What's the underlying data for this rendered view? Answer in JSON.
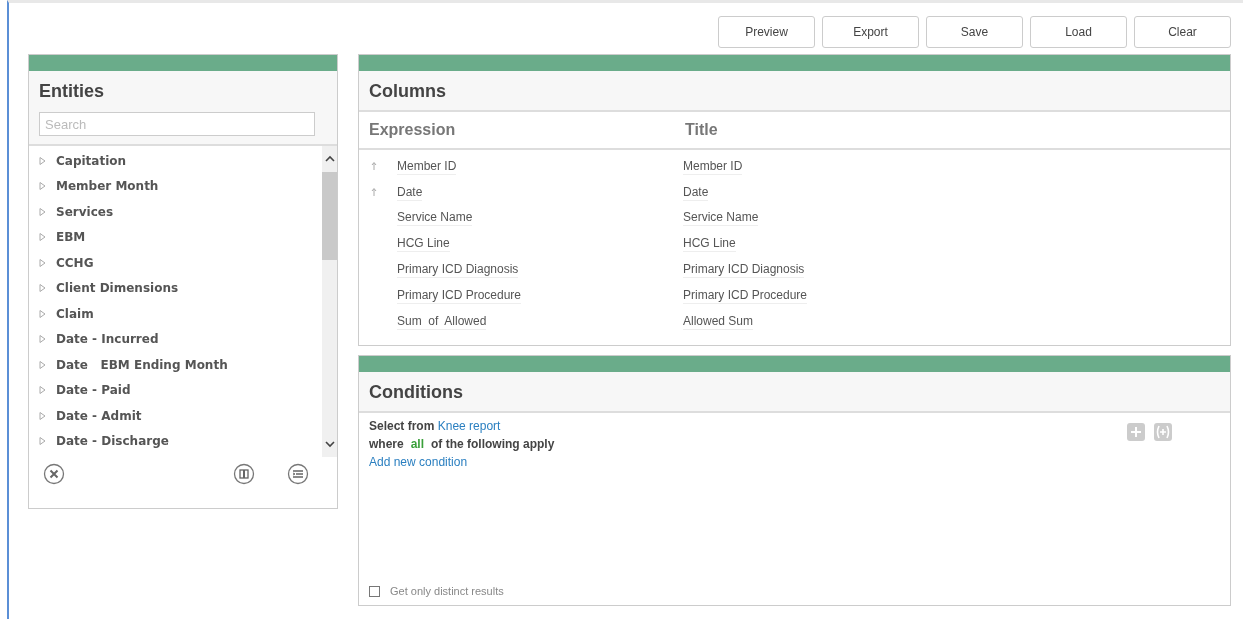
{
  "toolbar": {
    "buttons": [
      "Preview",
      "Export",
      "Save",
      "Load",
      "Clear"
    ]
  },
  "entities": {
    "title": "Entities",
    "search": {
      "placeholder": "Search"
    },
    "items": [
      {
        "label": "Capitation",
        "expanded": false
      },
      {
        "label": "Member Month",
        "expanded": false
      },
      {
        "label": "Services",
        "expanded": false
      },
      {
        "label": "EBM",
        "expanded": false
      },
      {
        "label": "CCHG",
        "expanded": false
      },
      {
        "label": "Client Dimensions",
        "expanded": false
      },
      {
        "label": "Claim",
        "expanded": false
      },
      {
        "label": "Date - Incurred",
        "expanded": false
      },
      {
        "label": "Date   EBM Ending Month",
        "expanded": false
      },
      {
        "label": "Date - Paid",
        "expanded": false
      },
      {
        "label": "Date - Admit",
        "expanded": false
      },
      {
        "label": "Date - Discharge",
        "expanded": false
      }
    ]
  },
  "columns": {
    "title": "Columns",
    "headers": [
      "Expression",
      "Title"
    ],
    "rows": [
      {
        "expression": "Member ID",
        "title": "Member ID",
        "sorted": true
      },
      {
        "expression": "Date",
        "title": "Date",
        "sorted": true
      },
      {
        "expression": "Service Name",
        "title": "Service Name",
        "sorted": false
      },
      {
        "expression": "HCG Line",
        "title": "HCG Line",
        "sorted": false
      },
      {
        "expression": "Primary ICD Diagnosis",
        "title": "Primary ICD Diagnosis",
        "sorted": false
      },
      {
        "expression": "Primary ICD Procedure",
        "title": "Primary ICD Procedure",
        "sorted": false
      },
      {
        "expression": "Sum  of  Allowed",
        "title": "Allowed Sum",
        "sorted": false
      }
    ]
  },
  "conditions": {
    "title": "Conditions",
    "select_label": "Select from",
    "source_link": "Knee report",
    "where_label": "where",
    "quantifier": "all",
    "apply_label": "of the following apply",
    "add_link": "Add new condition",
    "distinct": {
      "label": "Get only distinct results",
      "checked": false
    }
  }
}
